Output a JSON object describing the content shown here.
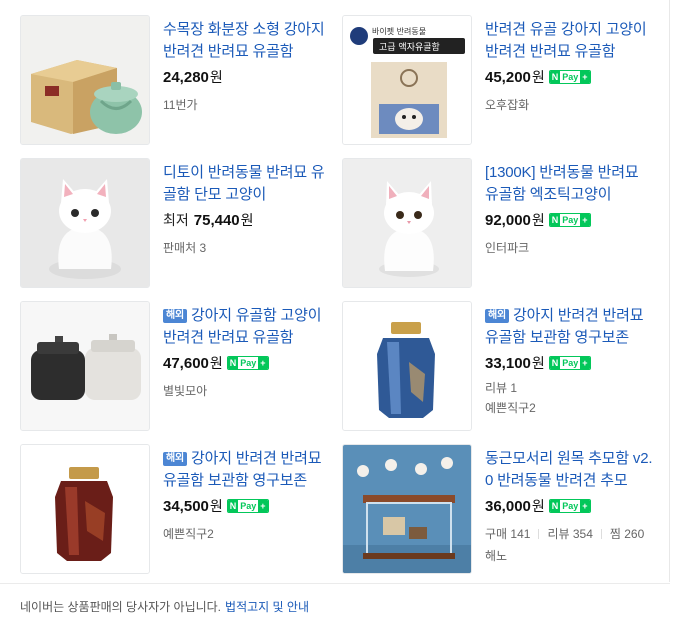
{
  "products": [
    {
      "title": "수목장 화분장 소형 강아지 반려견 반려묘 유골함",
      "price": "24,280",
      "unit": "원",
      "npay": false,
      "seller": "11번가"
    },
    {
      "title": "반려견 유골 강아지 고양이 반려견 반려묘 유골함",
      "price": "45,200",
      "unit": "원",
      "npay": true,
      "seller": "오후잡화",
      "thumb_top_text": "바이펫 반려동물",
      "thumb_box_text": "고급 액자유골함"
    },
    {
      "title": "디토이 반려동물 반려묘 유골함 단모 고양이",
      "prefix": "최저",
      "price": "75,440",
      "unit": "원",
      "npay": false,
      "seller": "판매처 3"
    },
    {
      "title": "[1300K] 반려동물 반려묘 유골함 엑조틱고양이",
      "price": "92,000",
      "unit": "원",
      "npay": true,
      "seller": "인터파크"
    },
    {
      "badge": "해외",
      "title": "강아지 유골함 고양이 반려견 반려묘 유골함",
      "price": "47,600",
      "unit": "원",
      "npay": true,
      "seller": "별빛모아"
    },
    {
      "badge": "해외",
      "title": "강아지 반려견 반려묘 유골함 보관함 영구보존",
      "price": "33,100",
      "unit": "원",
      "npay": true,
      "review": "리뷰 1",
      "seller": "예쁜직구2"
    },
    {
      "badge": "해외",
      "title": "강아지 반려견 반려묘 유골함 보관함 영구보존",
      "price": "34,500",
      "unit": "원",
      "npay": true,
      "seller": "예쁜직구2"
    },
    {
      "title": "동근모서리 원목 추모함 v2.0 반려동물 반려견 추모",
      "price": "36,000",
      "unit": "원",
      "npay": true,
      "stats": [
        "구매 141",
        "리뷰 354",
        "찜 260"
      ],
      "seller": "해노"
    }
  ],
  "npay": {
    "n": "N",
    "pay": "Pay",
    "plus": "+"
  },
  "footer": {
    "notice": "네이버는 상품판매의 당사자가 아닙니다.",
    "link": "법적고지 및 안내"
  },
  "colors": {
    "title": "#1b5ab8",
    "npay": "#03c75a",
    "overseas_badge": "#4c86d4"
  }
}
